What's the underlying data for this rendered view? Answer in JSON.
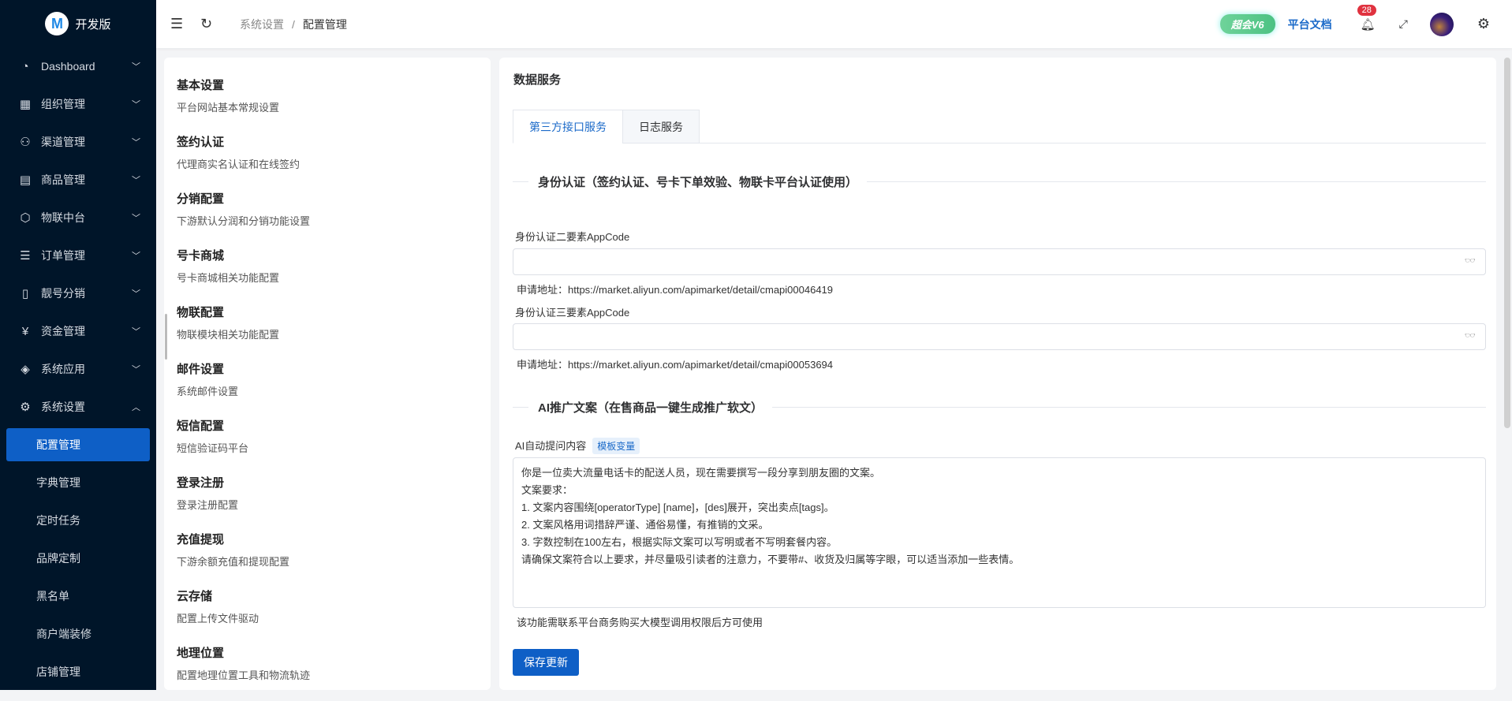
{
  "sidebar": {
    "logo": "开发版",
    "items": [
      {
        "label": "Dashboard",
        "icon": "dashboard-icon",
        "glyph": "◔"
      },
      {
        "label": "组织管理",
        "icon": "grid-icon",
        "glyph": "▦"
      },
      {
        "label": "渠道管理",
        "icon": "network-icon",
        "glyph": "⚇"
      },
      {
        "label": "商品管理",
        "icon": "store-icon",
        "glyph": "▤"
      },
      {
        "label": "物联中台",
        "icon": "cube-icon",
        "glyph": "⬡"
      },
      {
        "label": "订单管理",
        "icon": "list-icon",
        "glyph": "☰"
      },
      {
        "label": "靓号分销",
        "icon": "phone-icon",
        "glyph": "▯"
      },
      {
        "label": "资金管理",
        "icon": "yuan-icon",
        "glyph": "¥"
      },
      {
        "label": "系统应用",
        "icon": "box-icon",
        "glyph": "◈"
      },
      {
        "label": "系统设置",
        "icon": "gear-icon",
        "glyph": "⚙"
      }
    ],
    "subitems": [
      "配置管理",
      "字典管理",
      "定时任务",
      "品牌定制",
      "黑名单",
      "商户端装修",
      "店铺管理"
    ]
  },
  "header": {
    "breadcrumb": [
      "系统设置",
      "配置管理"
    ],
    "sep": "/",
    "version_badge": "超会V6",
    "docs": "平台文档",
    "notifications": "28"
  },
  "config_list": [
    {
      "title": "基本设置",
      "desc": "平台网站基本常规设置"
    },
    {
      "title": "签约认证",
      "desc": "代理商实名认证和在线签约"
    },
    {
      "title": "分销配置",
      "desc": "下游默认分润和分销功能设置"
    },
    {
      "title": "号卡商城",
      "desc": "号卡商城相关功能配置"
    },
    {
      "title": "物联配置",
      "desc": "物联模块相关功能配置"
    },
    {
      "title": "邮件设置",
      "desc": "系统邮件设置"
    },
    {
      "title": "短信配置",
      "desc": "短信验证码平台"
    },
    {
      "title": "登录注册",
      "desc": "登录注册配置"
    },
    {
      "title": "充值提现",
      "desc": "下游余额充值和提现配置"
    },
    {
      "title": "云存储",
      "desc": "配置上传文件驱动"
    },
    {
      "title": "地理位置",
      "desc": "配置地理位置工具和物流轨迹"
    }
  ],
  "main": {
    "title": "数据服务",
    "tabs": [
      "第三方接口服务",
      "日志服务"
    ],
    "section1": "身份认证（签约认证、号卡下单效验、物联卡平台认证使用）",
    "field1_label": "身份认证二要素AppCode",
    "field1_value": "",
    "field1_hint": "申请地址：https://market.aliyun.com/apimarket/detail/cmapi00046419",
    "field2_label": "身份认证三要素AppCode",
    "field2_value": "",
    "field2_hint": "申请地址：https://market.aliyun.com/apimarket/detail/cmapi00053694",
    "section2": "AI推广文案（在售商品一键生成推广软文）",
    "ai_label": "AI自动提问内容",
    "ai_tag": "模板变量",
    "ai_prompt": "你是一位卖大流量电话卡的配送人员，现在需要撰写一段分享到朋友圈的文案。\n文案要求：\n1. 文案内容围绕[operatorType] [name]，[des]展开，突出卖点[tags]。\n2. 文案风格用词措辞严谨、通俗易懂，有推销的文采。\n3. 字数控制在100左右，根据实际文案可以写明或者不写明套餐内容。\n请确保文案符合以上要求，并尽量吸引读者的注意力，不要带#、收货及归属等字眼，可以适当添加一些表情。",
    "ai_hint": "该功能需联系平台商务购买大模型调用权限后方可使用",
    "save": "保存更新"
  }
}
